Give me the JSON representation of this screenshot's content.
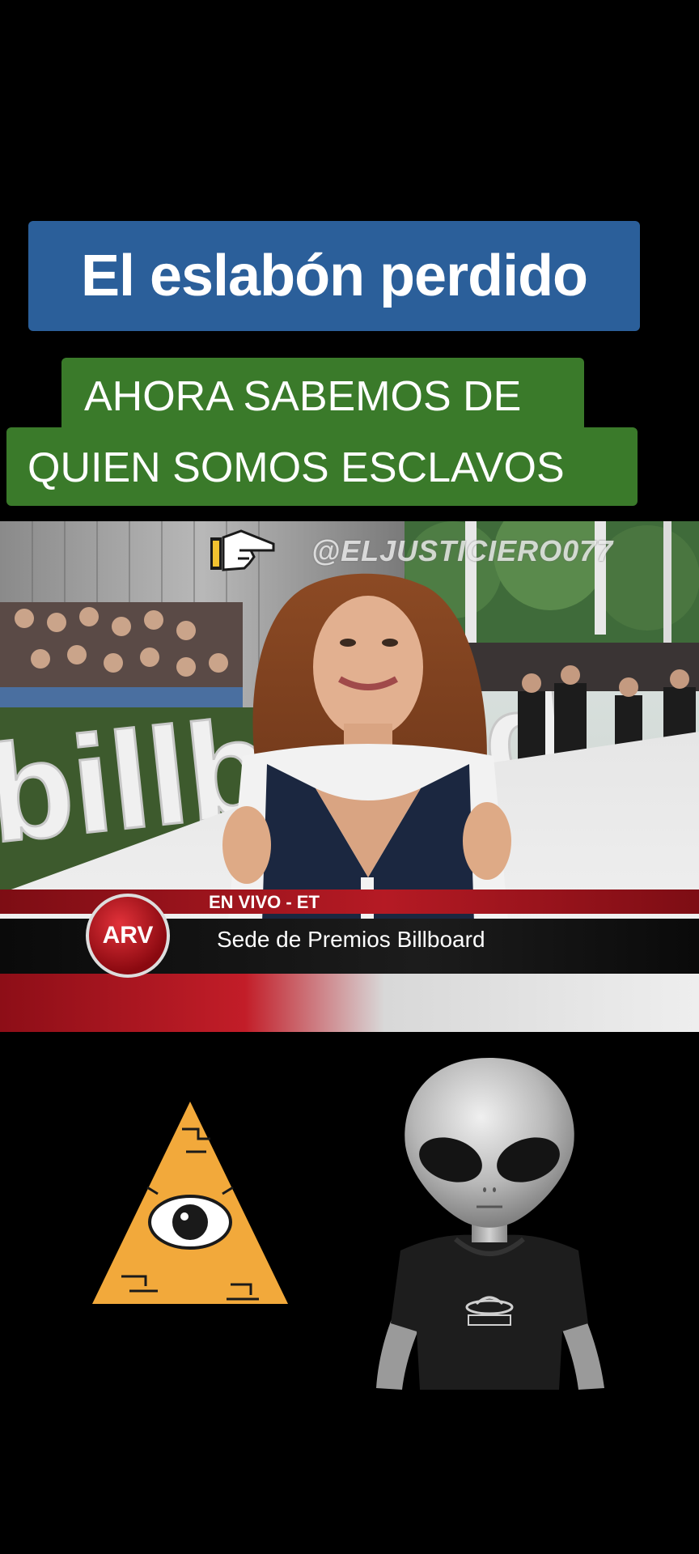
{
  "overlay": {
    "title": "El eslabón perdido",
    "subtitle_line1": "AHORA SABEMOS DE",
    "subtitle_line2": "QUIEN SOMOS ESCLAVOS"
  },
  "video": {
    "watermark": "@ELJUSTICIERO077",
    "live_label": "EN VIVO - ET",
    "channel_logo": "ARV",
    "venue_caption": "Sede de Premios Billboard",
    "backdrop_sign": "billboard"
  },
  "colors": {
    "title_bg": "#2b5f9a",
    "subtitle_bg": "#3a7a2a",
    "lower_third_red": "#b51a24",
    "pyramid": "#f2a93b"
  },
  "icons": {
    "pointer": "pointing-hand-icon",
    "pyramid": "all-seeing-eye-pyramid-icon",
    "alien": "alien-figure"
  }
}
